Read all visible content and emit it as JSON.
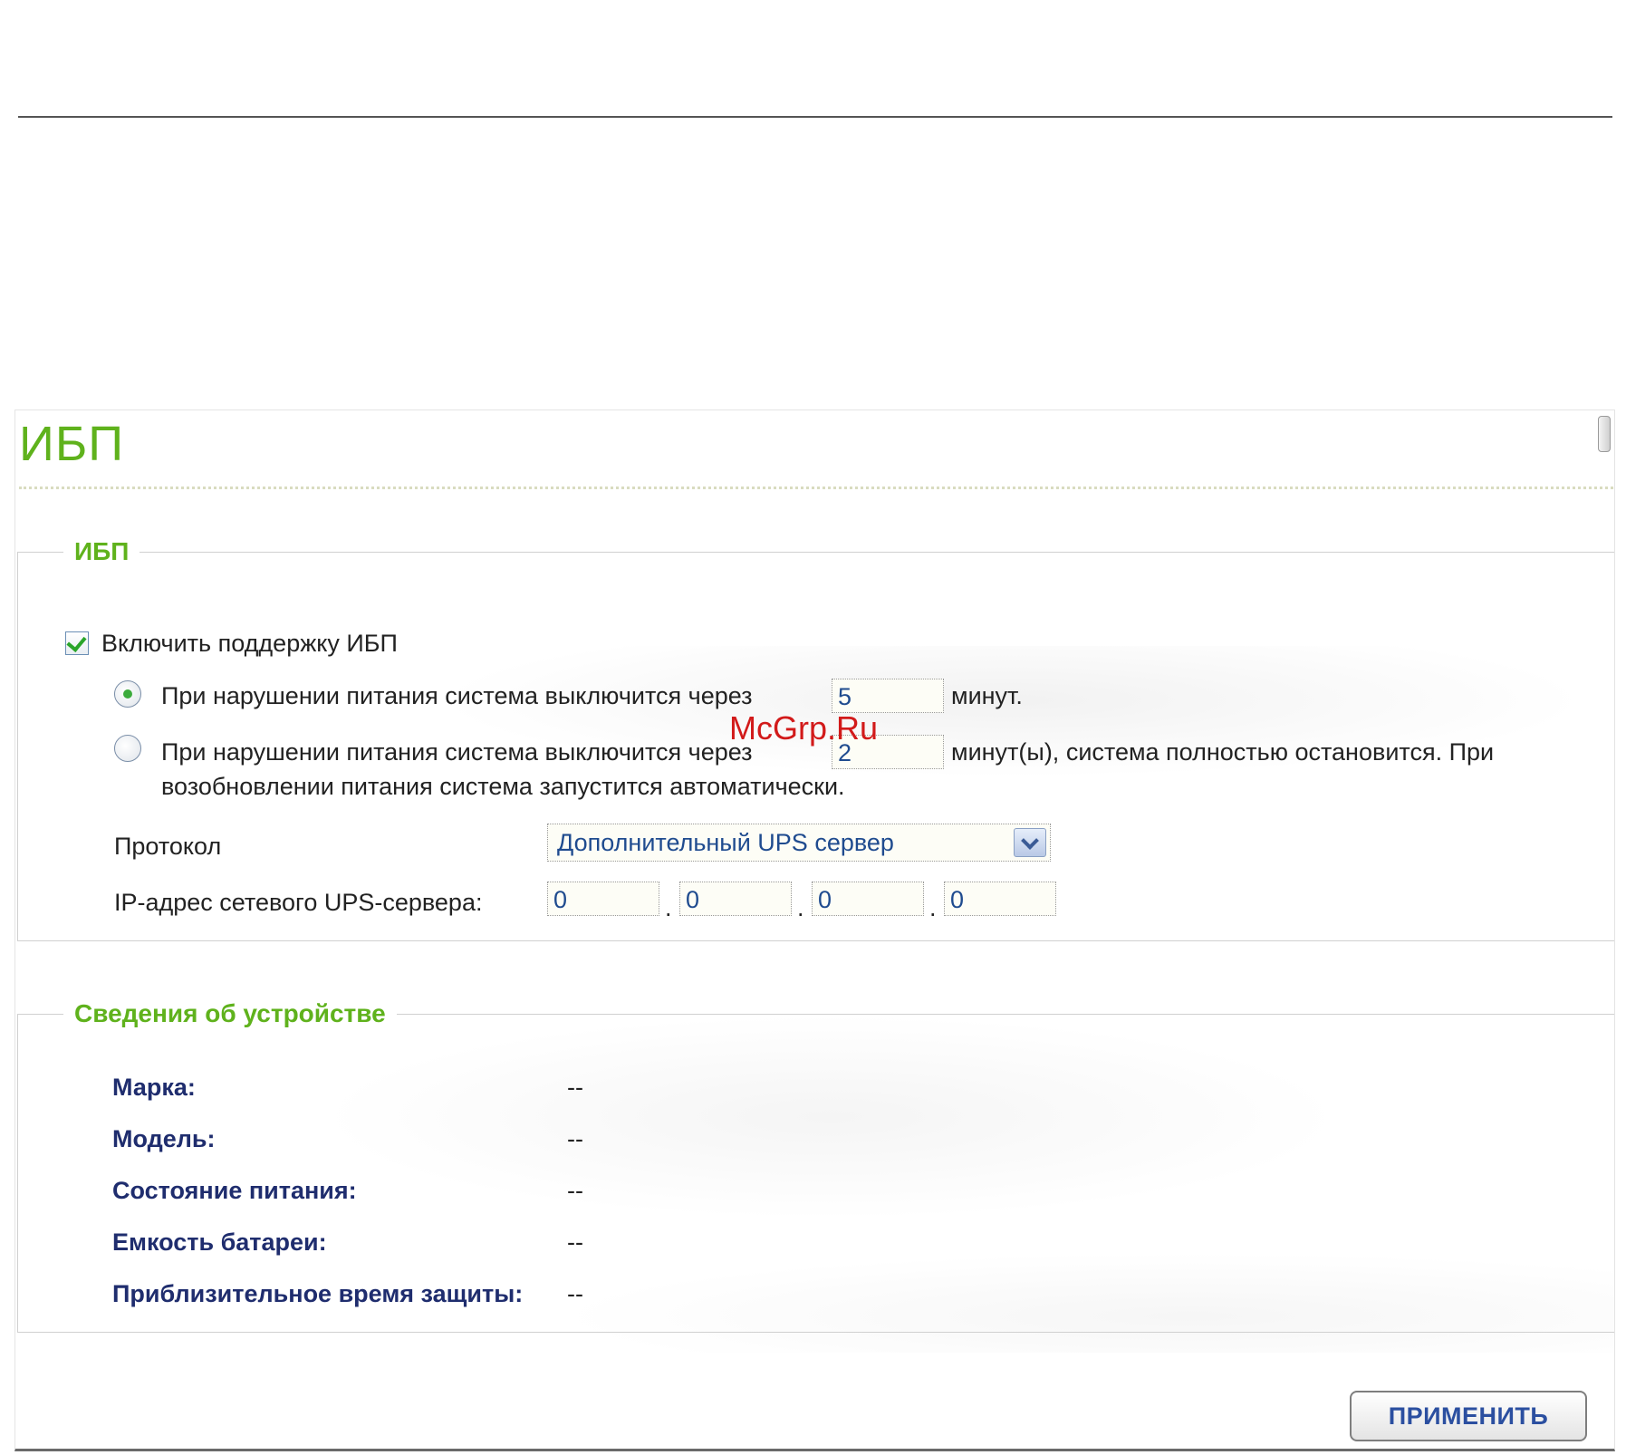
{
  "page": {
    "title": "ИБП",
    "watermark": "McGrp.Ru"
  },
  "ups_section": {
    "legend": "ИБП",
    "enable_checkbox": {
      "label": "Включить поддержку ИБП",
      "checked": true
    },
    "option_shutdown": {
      "label_before": "При нарушении питания система выключится через",
      "minutes": "5",
      "label_after": "минут.",
      "selected": true
    },
    "option_halt": {
      "label_before": "При нарушении питания система выключится через",
      "minutes": "2",
      "label_after": "минут(ы), система полностью остановится. При",
      "label_line2": "возобновлении питания система запустится автоматически.",
      "selected": false
    },
    "protocol": {
      "label": "Протокол",
      "value": "Дополнительный UPS сервер"
    },
    "ip": {
      "label": "IP-адрес сетевого UPS-сервера:",
      "octets": [
        "0",
        "0",
        "0",
        "0"
      ],
      "separator": "."
    }
  },
  "device_section": {
    "legend": "Сведения об устройстве",
    "rows": [
      {
        "key": "Марка:",
        "value": "--"
      },
      {
        "key": "Модель:",
        "value": "--"
      },
      {
        "key": "Состояние питания:",
        "value": "--"
      },
      {
        "key": "Емкость батареи:",
        "value": "--"
      },
      {
        "key": "Приблизительное время защиты:",
        "value": "--"
      }
    ]
  },
  "actions": {
    "apply_label": "ПРИМЕНИТЬ"
  },
  "colors": {
    "accent_green": "#5fb21c",
    "label_navy": "#1f2d6e",
    "value_blue": "#1f4b8f"
  }
}
